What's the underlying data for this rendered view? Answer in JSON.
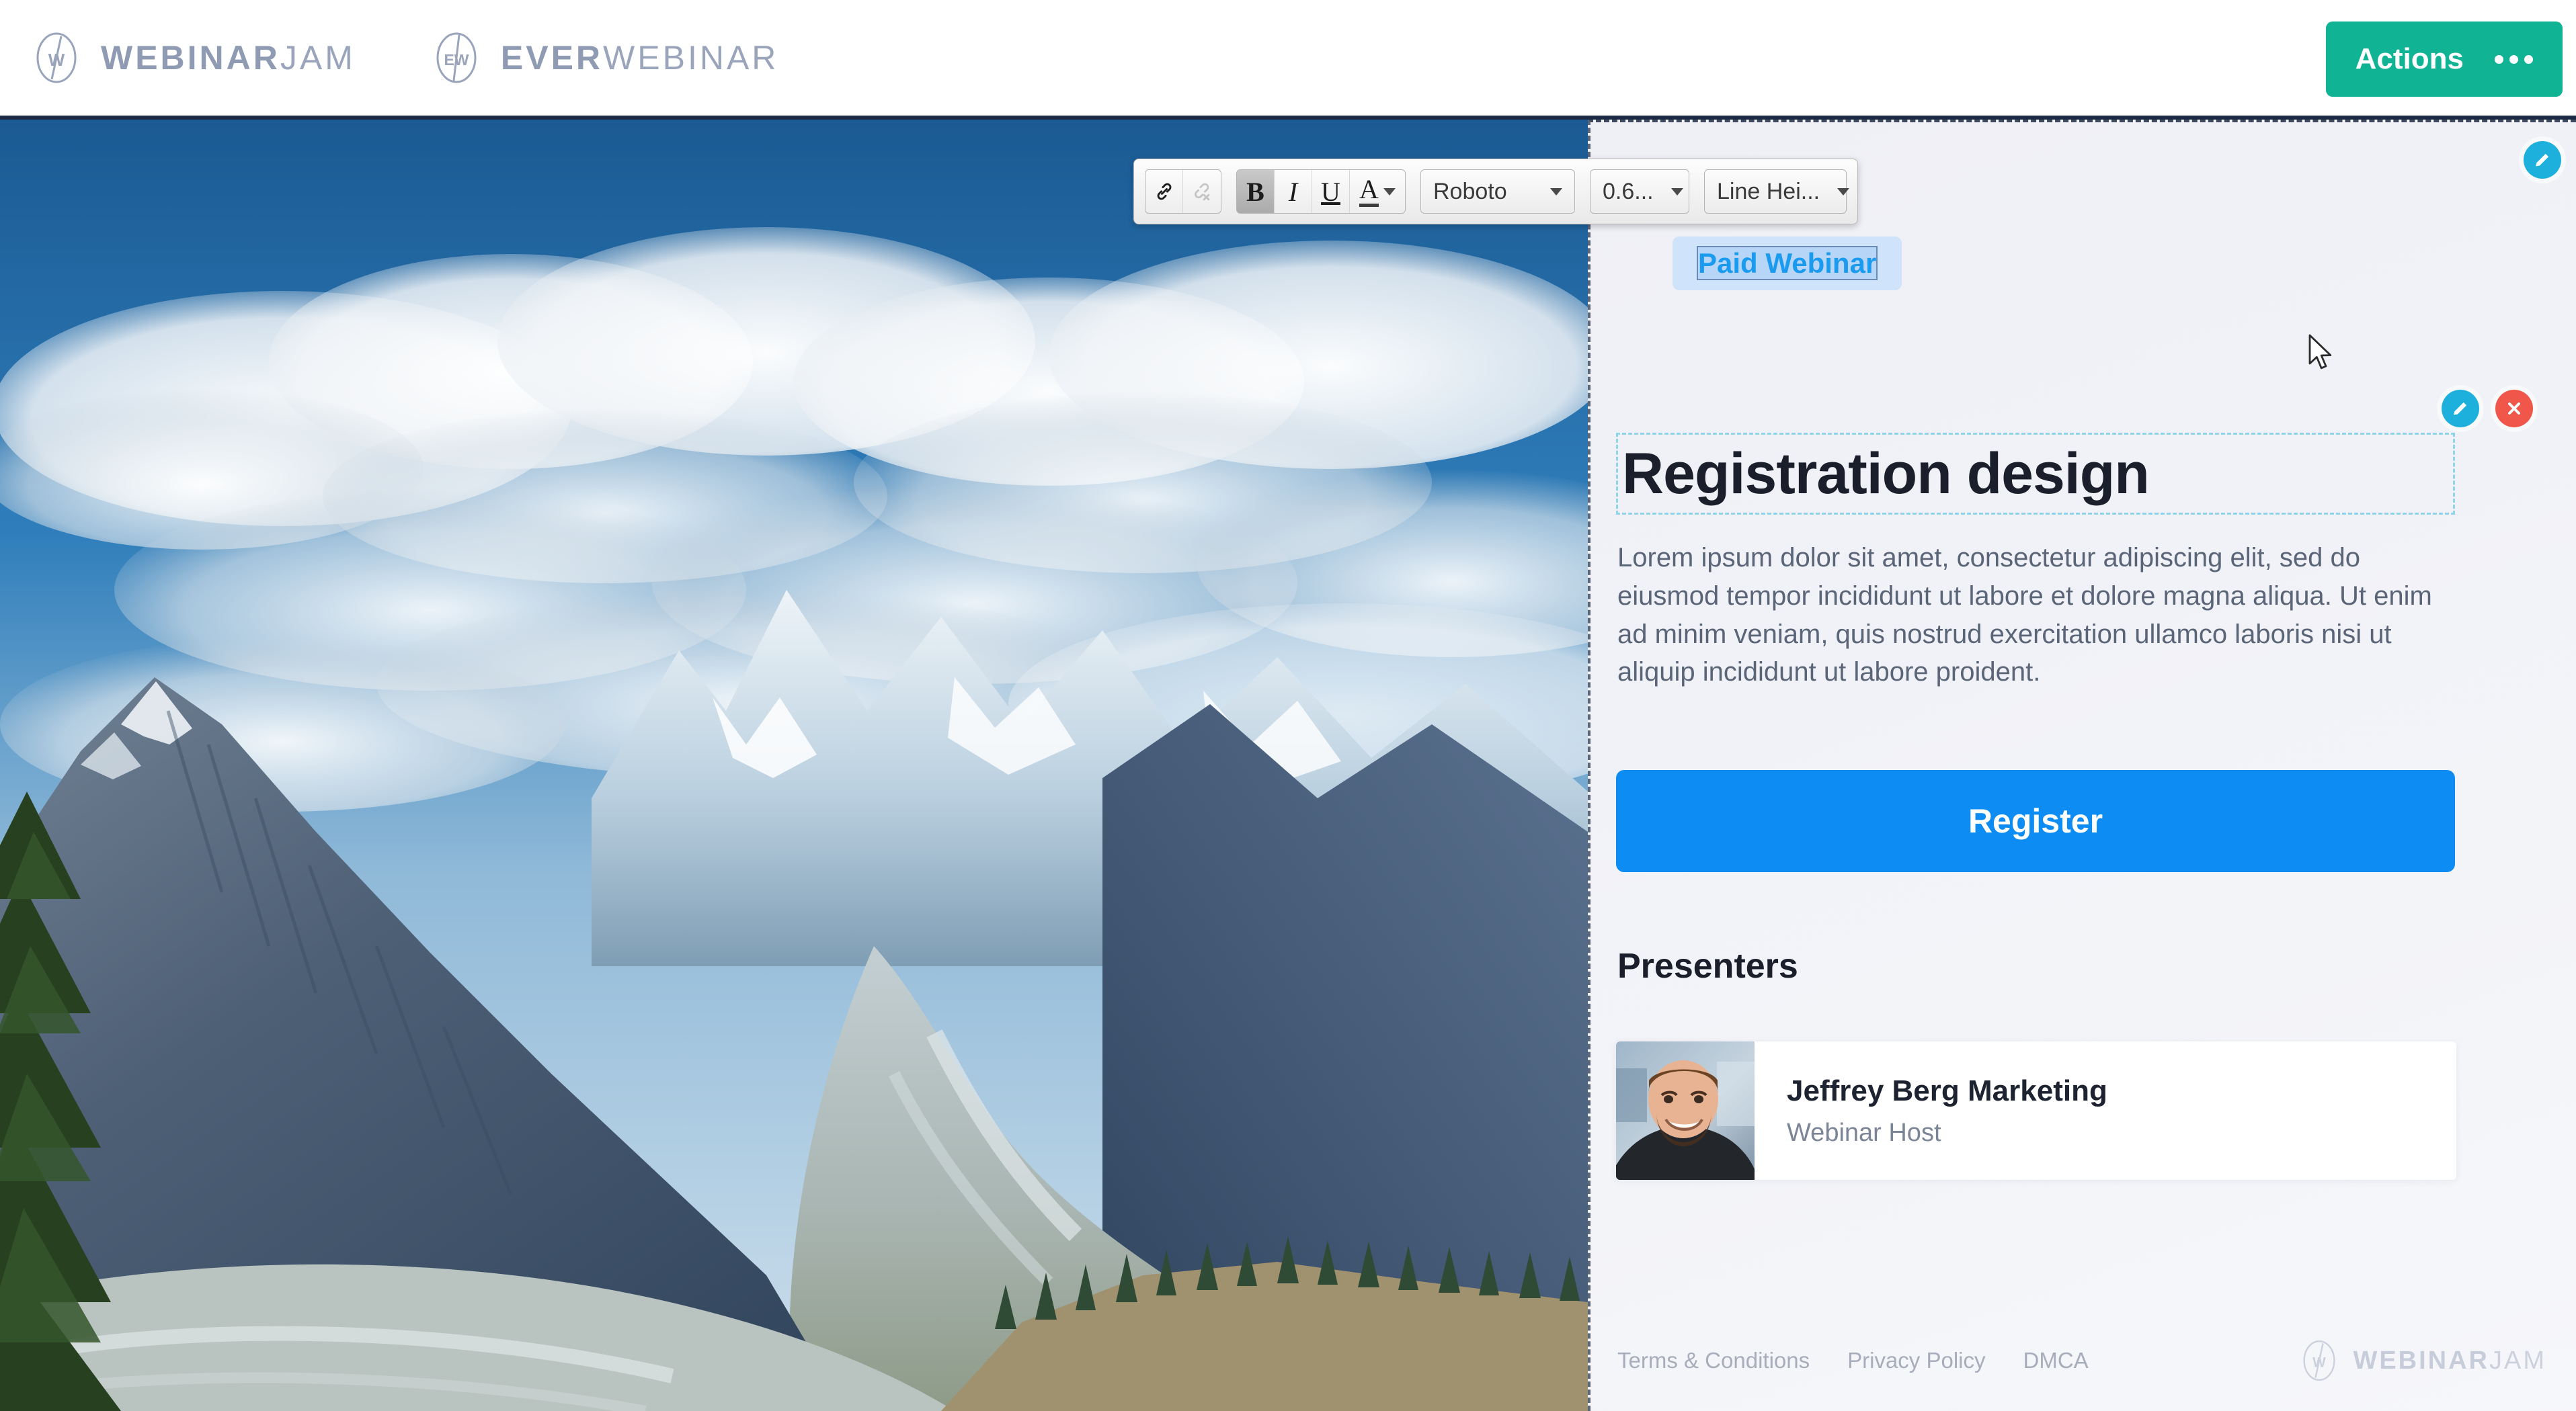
{
  "header": {
    "brands": [
      {
        "mark": "webinarjam-logo-icon",
        "prefix": "WEBINAR",
        "suffix": "JAM"
      },
      {
        "mark": "everwebinar-logo-icon",
        "prefix": "EVER",
        "suffix": "WEBINAR"
      }
    ],
    "actions_label": "Actions",
    "actions_menu_icon": "ellipsis-icon",
    "actions_color": "#10b394"
  },
  "toolbar": {
    "link_icon": "link-icon",
    "unlink_icon": "unlink-icon",
    "bold_label": "B",
    "italic_label": "I",
    "underline_label": "U",
    "font_color_label": "A",
    "font_family": "Roboto",
    "font_size": "0.6...",
    "line_height": "Line Hei...",
    "bold_active": true,
    "unlink_disabled": true
  },
  "panel": {
    "edit_fab_icon": "pencil-icon",
    "badge": "Paid Webinar",
    "badge_text_color": "#1a9bf0",
    "badge_bg_color": "#cfe4fb",
    "headline": "Registration design",
    "block_actions": {
      "edit_icon": "pencil-icon",
      "edit_color": "#1eb0dd",
      "delete_icon": "close-x-icon",
      "delete_color": "#f0564a"
    },
    "body": "Lorem ipsum dolor sit amet, consectetur adipiscing elit, sed do eiusmod tempor incididunt ut labore et dolore magna aliqua. Ut enim ad minim veniam, quis nostrud exercitation ullamco laboris nisi ut aliquip incididunt ut labore proident.",
    "register_label": "Register",
    "register_color": "#0d8cf4",
    "presenters_title": "Presenters",
    "presenters": [
      {
        "avatar": "presenter-photo",
        "name": "Jeffrey Berg Marketing",
        "role": "Webinar Host"
      }
    ],
    "footer": {
      "links": [
        "Terms & Conditions",
        "Privacy Policy",
        "DMCA"
      ],
      "brand": {
        "mark": "webinarjam-logo-icon",
        "prefix": "WEBINAR",
        "suffix": "JAM"
      }
    }
  },
  "hero": {
    "alt": "mountain-valley-landscape"
  },
  "cursor": {
    "icon": "arrow-cursor"
  }
}
